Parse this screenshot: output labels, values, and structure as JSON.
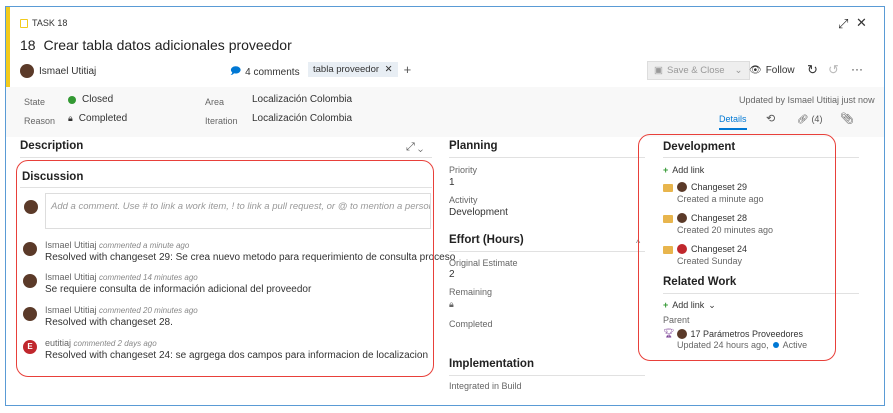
{
  "header": {
    "type_label": "TASK 18",
    "id": "18",
    "title": "Crear tabla datos adicionales proveedor",
    "assignee": "Ismael Utitiaj",
    "comments": "4 comments",
    "tag": "tabla proveedor",
    "save_label": "Save & Close",
    "follow_label": "Follow"
  },
  "fields": {
    "state_label": "State",
    "state_value": "Closed",
    "reason_label": "Reason",
    "reason_value": "Completed",
    "area_label": "Area",
    "area_value": "Localización Colombia",
    "iteration_label": "Iteration",
    "iteration_value": "Localización Colombia",
    "updated_by": "Updated by Ismael Utitiaj just now"
  },
  "tabs": {
    "details": "Details",
    "links": "(4)"
  },
  "description": {
    "title": "Description"
  },
  "discussion": {
    "title": "Discussion",
    "placeholder": "Add a comment. Use # to link a work item, ! to link a pull request, or @ to mention a person.",
    "comments": [
      {
        "author": "Ismael Utitiaj",
        "time": "commented a minute ago",
        "text": "Resolved with changeset 29: Se crea nuevo metodo para requerimiento de consulta proceso"
      },
      {
        "author": "Ismael Utitiaj",
        "time": "commented 14 minutes ago",
        "text": "Se requiere consulta de información adicional del proveedor"
      },
      {
        "author": "Ismael Utitiaj",
        "time": "commented 20 minutes ago",
        "text": "Resolved with changeset 28."
      },
      {
        "author": "eutitiaj",
        "time": "commented 2 days ago",
        "text": "Resolved with changeset 24: se agrgega dos campos para informacion de localizacion",
        "initial": "E"
      }
    ]
  },
  "planning": {
    "title": "Planning",
    "priority_label": "Priority",
    "priority_value": "1",
    "activity_label": "Activity",
    "activity_value": "Development"
  },
  "effort": {
    "title": "Effort (Hours)",
    "original_label": "Original Estimate",
    "original_value": "2",
    "remaining_label": "Remaining",
    "completed_label": "Completed"
  },
  "implementation": {
    "title": "Implementation",
    "integrated_label": "Integrated in Build"
  },
  "development": {
    "title": "Development",
    "add_link": "Add link",
    "items": [
      {
        "name": "Changeset 29",
        "sub": "Created a minute ago"
      },
      {
        "name": "Changeset 28",
        "sub": "Created 20 minutes ago"
      },
      {
        "name": "Changeset 24",
        "sub": "Created Sunday"
      }
    ]
  },
  "related": {
    "title": "Related Work",
    "add_link": "Add link",
    "parent_label": "Parent",
    "parent_item": "17 Parámetros Proveedores",
    "parent_updated": "Updated 24 hours ago,",
    "parent_state": "Active"
  },
  "colors": {
    "accent": "#f2cb1d",
    "link_blue": "#0078d4",
    "closed_green": "#339933",
    "highlight_red": "#e8403a"
  }
}
